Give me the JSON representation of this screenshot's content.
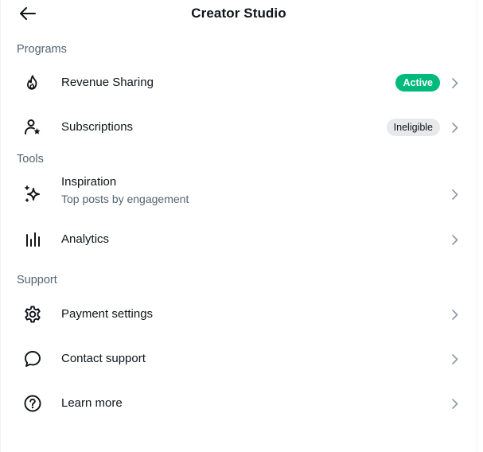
{
  "header": {
    "title": "Creator Studio",
    "back_icon": "arrow-left-icon"
  },
  "sections": [
    {
      "title": "Programs",
      "items": [
        {
          "label": "Revenue Sharing",
          "icon": "flame-icon",
          "badge": "Active",
          "badge_color": "#00ba7c"
        },
        {
          "label": "Subscriptions",
          "icon": "person-star-icon",
          "badge": "Ineligible",
          "badge_color": "#e7e9ea"
        }
      ]
    },
    {
      "title": "Tools",
      "items": [
        {
          "label": "Inspiration",
          "sublabel": "Top posts by engagement",
          "icon": "sparkle-icon"
        },
        {
          "label": "Analytics",
          "icon": "bar-chart-icon"
        }
      ]
    },
    {
      "title": "Support",
      "items": [
        {
          "label": "Payment settings",
          "icon": "gear-icon"
        },
        {
          "label": "Contact support",
          "icon": "chat-bubble-icon"
        },
        {
          "label": "Learn more",
          "icon": "question-circle-icon"
        }
      ]
    }
  ],
  "colors": {
    "text": "#0f1419",
    "secondary": "#536471",
    "active_badge": "#00ba7c",
    "ineligible_badge": "#e7e9ea"
  }
}
